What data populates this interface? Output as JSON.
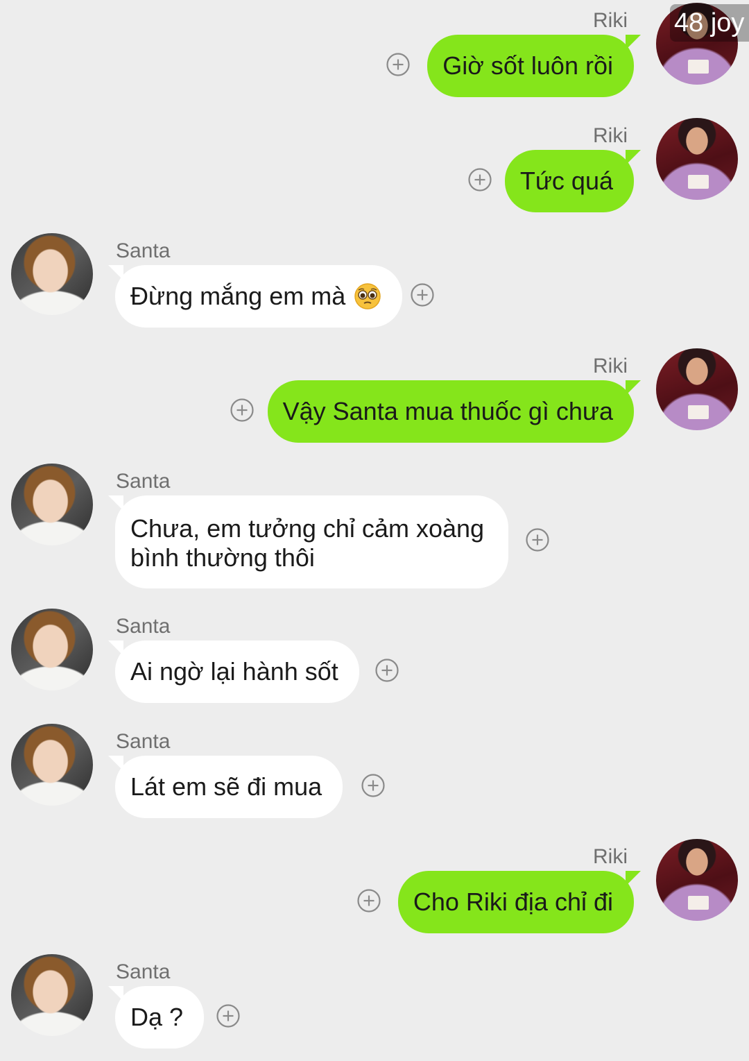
{
  "page_counter": "48 joy",
  "messages": [
    {
      "side": "out",
      "sender": "Riki",
      "text": "Giờ sốt luôn rồi"
    },
    {
      "side": "out",
      "sender": "Riki",
      "text": "Tức quá"
    },
    {
      "side": "in",
      "sender": "Santa",
      "text": "Đừng mắng em mà",
      "emoji": "pleading-face-emoji"
    },
    {
      "side": "out",
      "sender": "Riki",
      "text": "Vậy Santa mua thuốc gì chưa"
    },
    {
      "side": "in",
      "sender": "Santa",
      "text": "Chưa, em tưởng chỉ cảm xoàng bình thường thôi"
    },
    {
      "side": "in",
      "sender": "Santa",
      "text": "Ai ngờ lại hành sốt"
    },
    {
      "side": "in",
      "sender": "Santa",
      "text": "Lát em sẽ đi mua"
    },
    {
      "side": "out",
      "sender": "Riki",
      "text": "Cho Riki địa chỉ đi"
    },
    {
      "side": "in",
      "sender": "Santa",
      "text": "Dạ ?"
    }
  ],
  "icons": {
    "add_reaction": "plus-circle-icon",
    "riki_avatar": "riki-avatar-photo",
    "santa_avatar": "santa-avatar-photo"
  },
  "colors": {
    "background": "#ededed",
    "outgoing_bubble": "#85e51b",
    "incoming_bubble": "#ffffff",
    "sender_name": "#6f6f6f"
  }
}
